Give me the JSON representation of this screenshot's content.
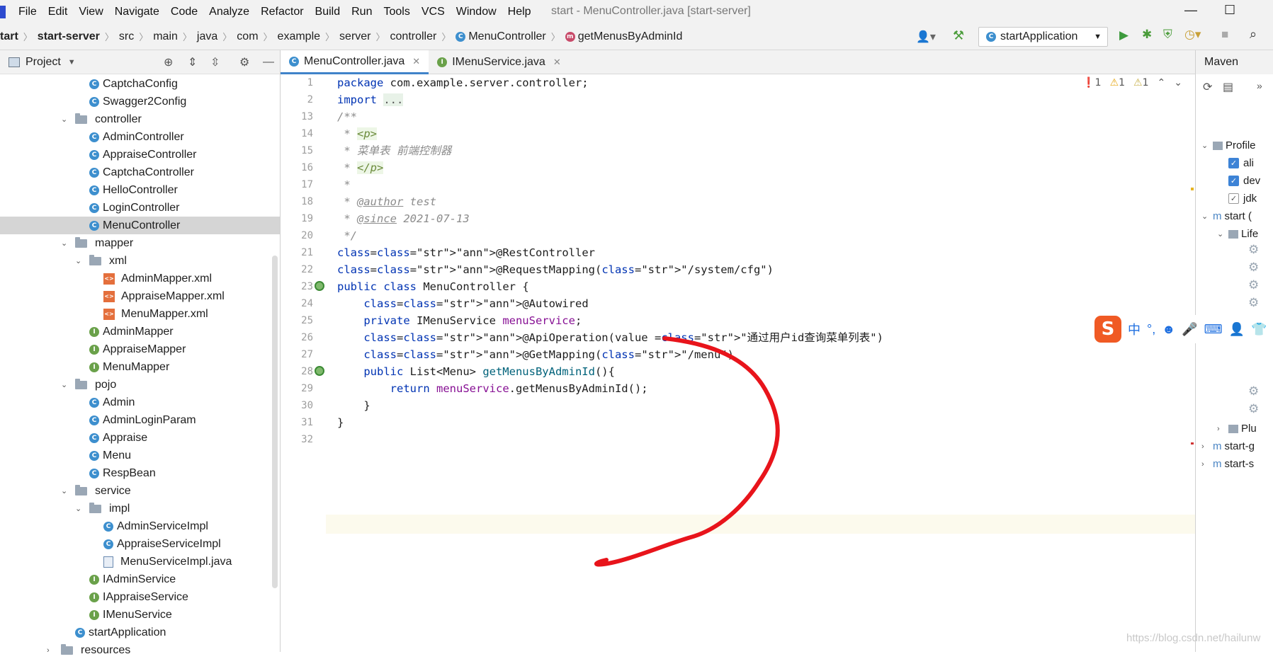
{
  "window": {
    "title": "start - MenuController.java [start-server]"
  },
  "menu": [
    {
      "label": "File"
    },
    {
      "label": "Edit"
    },
    {
      "label": "View"
    },
    {
      "label": "Navigate"
    },
    {
      "label": "Code"
    },
    {
      "label": "Analyze"
    },
    {
      "label": "Refactor"
    },
    {
      "label": "Build"
    },
    {
      "label": "Run"
    },
    {
      "label": "Tools"
    },
    {
      "label": "VCS"
    },
    {
      "label": "Window"
    },
    {
      "label": "Help"
    }
  ],
  "breadcrumbs": [
    "tart",
    "start-server",
    "src",
    "main",
    "java",
    "com",
    "example",
    "server",
    "controller",
    "MenuController",
    "getMenusByAdminId"
  ],
  "run_config": {
    "label": "startApplication"
  },
  "project_panel": {
    "title": "Project",
    "tree": [
      {
        "label": "CaptchaConfig",
        "icon": "class-icon",
        "depth": 3
      },
      {
        "label": "Swagger2Config",
        "icon": "class-icon",
        "depth": 3
      },
      {
        "label": "controller",
        "icon": "folder-icon",
        "depth": 2,
        "expanded": true
      },
      {
        "label": "AdminController",
        "icon": "class-icon",
        "depth": 3
      },
      {
        "label": "AppraiseController",
        "icon": "class-icon",
        "depth": 3
      },
      {
        "label": "CaptchaController",
        "icon": "class-icon",
        "depth": 3
      },
      {
        "label": "HelloController",
        "icon": "class-icon",
        "depth": 3
      },
      {
        "label": "LoginController",
        "icon": "class-icon",
        "depth": 3
      },
      {
        "label": "MenuController",
        "icon": "class-icon",
        "depth": 3,
        "selected": true
      },
      {
        "label": "mapper",
        "icon": "folder-icon",
        "depth": 2,
        "expanded": true
      },
      {
        "label": "xml",
        "icon": "folder-icon",
        "depth": 3,
        "expanded": true
      },
      {
        "label": "AdminMapper.xml",
        "icon": "xml-file-icon",
        "depth": 4
      },
      {
        "label": "AppraiseMapper.xml",
        "icon": "xml-file-icon",
        "depth": 4
      },
      {
        "label": "MenuMapper.xml",
        "icon": "xml-file-icon",
        "depth": 4
      },
      {
        "label": "AdminMapper",
        "icon": "interface-icon",
        "depth": 3
      },
      {
        "label": "AppraiseMapper",
        "icon": "interface-icon",
        "depth": 3
      },
      {
        "label": "MenuMapper",
        "icon": "interface-icon",
        "depth": 3
      },
      {
        "label": "pojo",
        "icon": "folder-icon",
        "depth": 2,
        "expanded": true
      },
      {
        "label": "Admin",
        "icon": "class-icon",
        "depth": 3
      },
      {
        "label": "AdminLoginParam",
        "icon": "class-icon",
        "depth": 3
      },
      {
        "label": "Appraise",
        "icon": "class-icon",
        "depth": 3
      },
      {
        "label": "Menu",
        "icon": "class-icon",
        "depth": 3
      },
      {
        "label": "RespBean",
        "icon": "class-icon",
        "depth": 3
      },
      {
        "label": "service",
        "icon": "folder-icon",
        "depth": 2,
        "expanded": true
      },
      {
        "label": "impl",
        "icon": "folder-icon",
        "depth": 3,
        "expanded": true
      },
      {
        "label": "AdminServiceImpl",
        "icon": "class-icon",
        "depth": 4
      },
      {
        "label": "AppraiseServiceImpl",
        "icon": "class-icon",
        "depth": 4
      },
      {
        "label": "MenuServiceImpl.java",
        "icon": "java-file-icon",
        "depth": 4
      },
      {
        "label": "IAdminService",
        "icon": "interface-icon",
        "depth": 3
      },
      {
        "label": "IAppraiseService",
        "icon": "interface-icon",
        "depth": 3
      },
      {
        "label": "IMenuService",
        "icon": "interface-icon",
        "depth": 3
      },
      {
        "label": "startApplication",
        "icon": "app-class-icon",
        "depth": 2
      },
      {
        "label": "resources",
        "icon": "folder-icon",
        "depth": 1,
        "expanded": false
      }
    ]
  },
  "editor": {
    "tabs": [
      {
        "label": "MenuController.java",
        "active": true,
        "icon": "class-icon"
      },
      {
        "label": "IMenuService.java",
        "active": false,
        "icon": "interface-icon"
      }
    ],
    "inspections": {
      "errors": "1",
      "warnings": "1",
      "weak_warnings": "1"
    },
    "lines": [
      {
        "n": "1",
        "code": "package com.example.server.controller;"
      },
      {
        "n": "2",
        "code": "import ..."
      },
      {
        "n": "13",
        "code": "/**"
      },
      {
        "n": "14",
        "code": " * <p>"
      },
      {
        "n": "15",
        "code": " * 菜单表 前端控制器"
      },
      {
        "n": "16",
        "code": " * </p>"
      },
      {
        "n": "17",
        "code": " *"
      },
      {
        "n": "18",
        "code": " * @author test"
      },
      {
        "n": "19",
        "code": " * @since 2021-07-13"
      },
      {
        "n": "20",
        "code": " */"
      },
      {
        "n": "21",
        "code": "@RestController"
      },
      {
        "n": "22",
        "code": "@RequestMapping(\"/system/cfg\")"
      },
      {
        "n": "23",
        "code": "public class MenuController {"
      },
      {
        "n": "24",
        "code": "    @Autowired"
      },
      {
        "n": "25",
        "code": "    private IMenuService menuService;"
      },
      {
        "n": "26",
        "code": "    @ApiOperation(value =\"通过用户id查询菜单列表\")"
      },
      {
        "n": "27",
        "code": "    @GetMapping(\"/menu\")"
      },
      {
        "n": "28",
        "code": "    public List<Menu> getMenusByAdminId(){"
      },
      {
        "n": "29",
        "code": "        return menuService.getMenusByAdminId();"
      },
      {
        "n": "30",
        "code": "    }"
      },
      {
        "n": "31",
        "code": "}"
      },
      {
        "n": "32",
        "code": ""
      }
    ]
  },
  "maven_panel": {
    "title": "Maven",
    "profiles_label": "Profile",
    "profiles": [
      {
        "label": "ali",
        "checked": true
      },
      {
        "label": "dev",
        "checked": true
      },
      {
        "label": "jdk",
        "checked": false
      }
    ],
    "items": [
      "start (",
      "Life",
      "Plu",
      "start-g",
      "start-s"
    ]
  },
  "ime": {
    "label": "中"
  },
  "watermark": "https://blog.csdn.net/hailunw",
  "colors": {
    "accent": "#4083c9",
    "annotation_red": "#e8141b",
    "chrome": "#f2f2f2"
  }
}
